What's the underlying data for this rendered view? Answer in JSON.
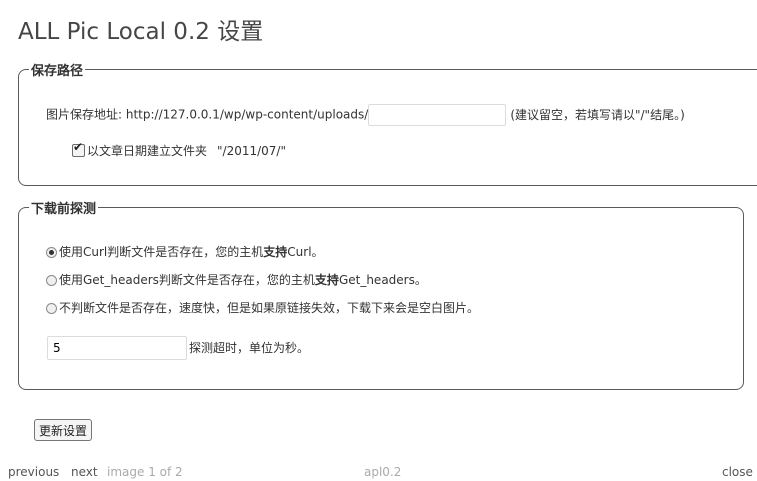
{
  "page": {
    "title": "ALL Pic Local 0.2 设置"
  },
  "save_path": {
    "legend": "保存路径",
    "label": "图片保存地址: http://127.0.0.1/wp/wp-content/uploads/",
    "input_value": "",
    "hint": "(建议留空，若填写请以\"/\"结尾。)",
    "date_folder_checked": true,
    "date_folder_label": "以文章日期建立文件夹",
    "date_folder_example": "\"/2011/07/\""
  },
  "detect": {
    "legend": "下载前探测",
    "options": [
      {
        "checked": true,
        "pre": "使用Curl判断文件是否存在，您的主机",
        "bold": "支持",
        "post": "Curl。"
      },
      {
        "checked": false,
        "pre": "使用Get_headers判断文件是否存在，您的主机",
        "bold": "支持",
        "post": "Get_headers。"
      },
      {
        "checked": false,
        "pre": "不判断文件是否存在，速度快，但是如果原链接失效，下载下来会是空白图片。",
        "bold": "",
        "post": ""
      }
    ],
    "timeout_value": "5",
    "timeout_label": "探测超时，单位为秒。"
  },
  "actions": {
    "update_label": "更新设置"
  },
  "footer": {
    "previous": "previous",
    "next": "next",
    "image_counter": "image 1 of 2",
    "caption": "apl0.2",
    "close": "close"
  }
}
